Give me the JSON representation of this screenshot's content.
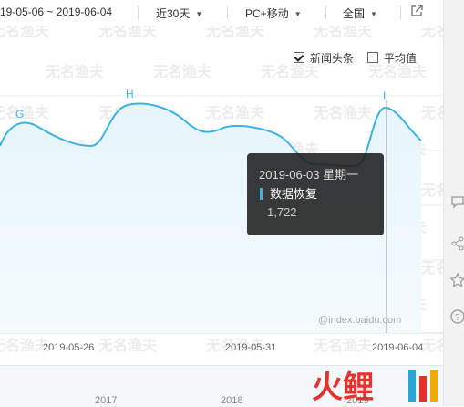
{
  "toolbar": {
    "date_range": "19-05-06 ~ 2019-06-04",
    "period": "近30天",
    "device": "PC+移动",
    "region": "全国"
  },
  "legend": {
    "news_label": "新闻头条",
    "news_checked": true,
    "avg_label": "平均值",
    "avg_checked": false
  },
  "tooltip": {
    "date": "2019-06-03 星期一",
    "series": "数据恢复",
    "value": "1,722"
  },
  "attribution": "@index.baidu.com",
  "x_ticks": [
    "2019-05-26",
    "2019-05-31",
    "2019-06-04"
  ],
  "timeline_years": [
    "2017",
    "2018",
    "2019"
  ],
  "markers": [
    "G",
    "H",
    "I"
  ],
  "watermark": "无名渔夫",
  "logo_text": "火鲤",
  "colors": {
    "line": "#3db3e0",
    "area": "#eef8fd"
  }
}
